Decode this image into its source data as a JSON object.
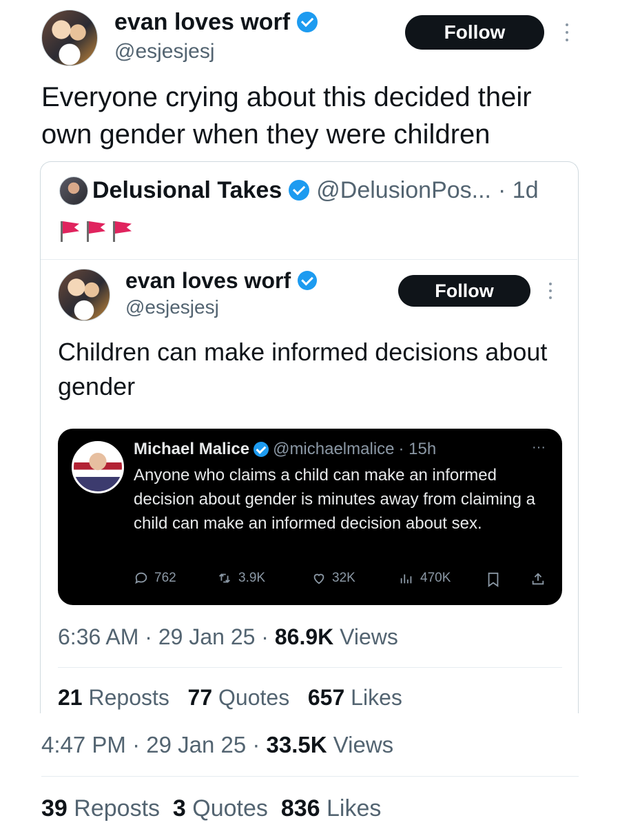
{
  "outer": {
    "author_name": "evan loves worf",
    "author_handle": "@esjesjesj",
    "follow_label": "Follow",
    "text": "Everyone crying about this decided their own gender when they were children",
    "timestamp": "4:47 PM · 29 Jan 25 · ",
    "views_count": "33.5K",
    "views_label": " Views",
    "reposts_count": "39",
    "reposts_label": "Reposts",
    "quotes_count": "3",
    "quotes_label": "Quotes",
    "likes_count": "836",
    "likes_label": "Likes"
  },
  "quote": {
    "author_name": "Delusional Takes",
    "author_handle": "@DelusionPos...",
    "age": "· 1d",
    "flags_emoji": "🚩🚩🚩"
  },
  "inner": {
    "author_name": "evan loves worf",
    "author_handle": "@esjesjesj",
    "follow_label": "Follow",
    "text": "Children can make informed decisions about gender",
    "timestamp": "6:36 AM · 29 Jan 25 · ",
    "views_count": "86.9K",
    "views_label": " Views",
    "reposts_count": "21",
    "reposts_label": "Reposts",
    "quotes_count": "77",
    "quotes_label": "Quotes",
    "likes_count": "657",
    "likes_label": "Likes"
  },
  "screenshot": {
    "author_name": "Michael Malice",
    "author_handle": "@michaelmalice",
    "age": "· 15h",
    "more_label": "···",
    "text": "Anyone who claims a child can make an informed decision about gender is minutes away from claiming a child can make an informed decision about sex.",
    "replies": "762",
    "reposts": "3.9K",
    "likes": "32K",
    "views": "470K"
  },
  "colors": {
    "verified": "#1d9bf0",
    "follow_bg": "#0f1419",
    "card_border": "#cfd9de",
    "secondary_text": "#536471"
  }
}
